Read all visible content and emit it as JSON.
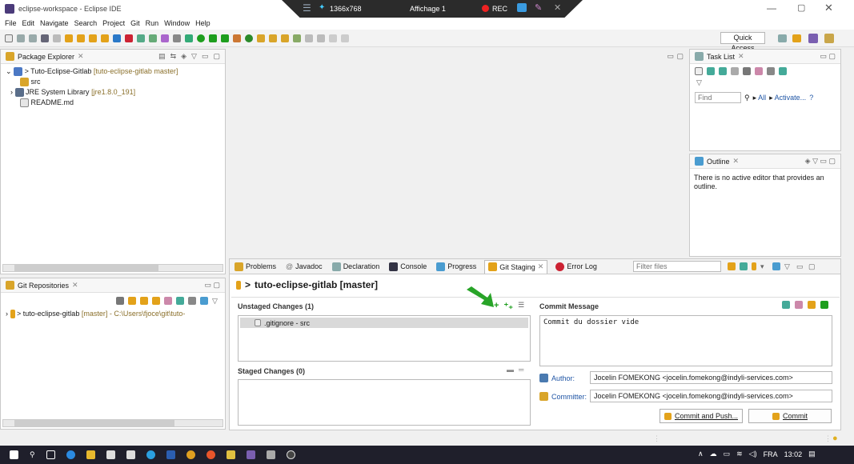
{
  "window": {
    "title": "eclipse-workspace - Eclipse IDE"
  },
  "recorder": {
    "resolution": "1366x768",
    "display": "Affichage 1",
    "rec_label": "REC"
  },
  "menu": [
    "File",
    "Edit",
    "Navigate",
    "Search",
    "Project",
    "Git",
    "Run",
    "Window",
    "Help"
  ],
  "toolbar": {
    "quick_access": "Quick Access"
  },
  "package_explorer": {
    "title": "Package Explorer",
    "project": {
      "name": "Tuto-Eclipse-Gitlab",
      "decoration": "[tuto-eclipse-gitlab master]"
    },
    "src": "src",
    "jre": {
      "name": "JRE System Library",
      "decoration": "[jre1.8.0_191]"
    },
    "readme": "README.md"
  },
  "task_list": {
    "title": "Task List",
    "find_placeholder": "Find",
    "all_label": "All",
    "activate_label": "Activate..."
  },
  "outline": {
    "title": "Outline",
    "message": "There is no active editor that provides an outline."
  },
  "git_repositories": {
    "title": "Git Repositories",
    "repo": "tuto-eclipse-gitlab",
    "repo_decoration": "[master] - C:\\Users\\fjoce\\git\\tuto-"
  },
  "bottom_tabs": {
    "problems": "Problems",
    "javadoc": "Javadoc",
    "declaration": "Declaration",
    "console": "Console",
    "progress": "Progress",
    "git_staging": "Git Staging",
    "error_log": "Error Log",
    "filter_placeholder": "Filter files"
  },
  "staging": {
    "header": "tuto-eclipse-gitlab [master]",
    "unstaged_title": "Unstaged Changes (1)",
    "unstaged_files": [
      ".gitignore - src"
    ],
    "staged_title": "Staged Changes (0)",
    "commit_title": "Commit Message",
    "commit_message": "Commit du dossier vide",
    "author_label": "Author:",
    "author_value": "Jocelin FOMEKONG <jocelin.fomekong@indyli-services.com>",
    "committer_label": "Committer:",
    "committer_value": "Jocelin FOMEKONG <jocelin.fomekong@indyli-services.com>",
    "commit_push_label": "Commit and Push...",
    "commit_label": "Commit"
  },
  "system_tray": {
    "language": "FRA",
    "time": "13:02"
  },
  "colors": {
    "accent_green": "#1e9e1e",
    "selection": "#d9d9d9",
    "link": "#1f55a5",
    "arrow": "#28a428"
  }
}
